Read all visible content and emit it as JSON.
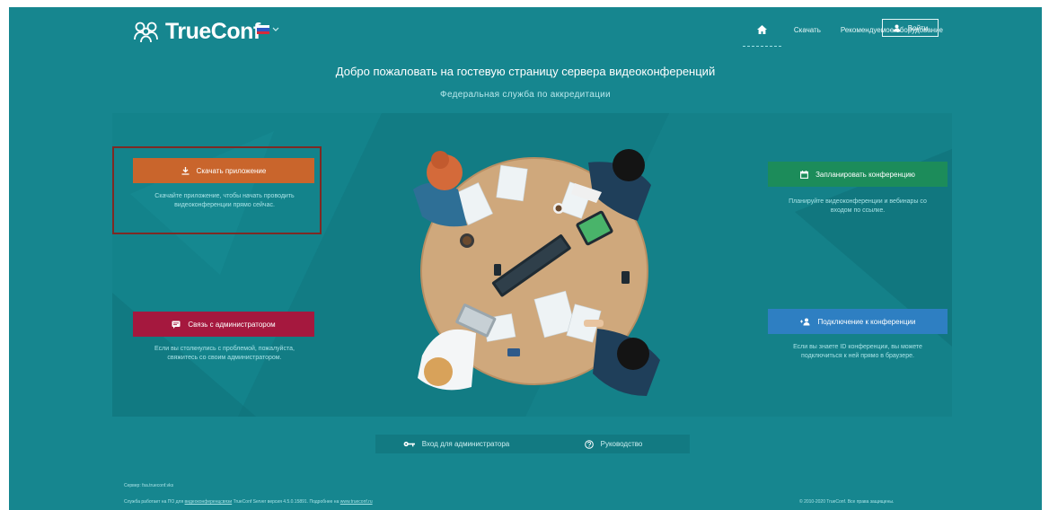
{
  "header": {
    "logo_text": "TrueConf",
    "nav": {
      "download": "Скачать",
      "equipment": "Рекомендуемое оборудование",
      "login": "Войти"
    }
  },
  "main": {
    "title": "Добро пожаловать на гостевую страницу сервера видеоконференций",
    "subtitle": "Федеральная служба по аккредитации"
  },
  "cards": {
    "download": {
      "label": "Скачать приложение",
      "desc": "Скачайте приложение, чтобы начать проводить видеоконференции прямо сейчас."
    },
    "schedule": {
      "label": "Запланировать конференцию",
      "desc": "Планируйте видеоконференции и вебинары со входом по ссылке."
    },
    "admin_contact": {
      "label": "Связь с администратором",
      "desc": "Если вы столкнулись с проблемой, пожалуйста, свяжитесь со своим администратором."
    },
    "join": {
      "label": "Подключение к конференции",
      "desc": "Если вы знаете ID конференции, вы можете подключиться к ней прямо в браузере."
    }
  },
  "bottom": {
    "admin_login": "Вход для администратора",
    "guide": "Руководство"
  },
  "footer": {
    "server": "Сервер: fsa.trueconf.vks",
    "powered_prefix": "Служба работает на ПО для",
    "powered_link": "видеоконференцсвязи",
    "powered_middle": "TrueConf Server версия 4.5.0.15891. Подробнее на",
    "site_link": "www.trueconf.ru",
    "copyright": "© 2010-2020 TrueConf. Все права защищены."
  },
  "colors": {
    "background": "#16868f",
    "panel": "#137e86",
    "download_btn": "#c9652c",
    "schedule_btn": "#1c8c5a",
    "admin_btn": "#a5183e",
    "join_btn": "#2e7fc2",
    "highlight_border": "#7d2a24"
  },
  "icons": {
    "logo": "people-logo-icon",
    "lang": "russian-flag-icon",
    "home": "home-icon",
    "login": "user-icon",
    "download": "download-icon",
    "schedule": "calendar-icon",
    "admin_contact": "chat-icon",
    "join": "add-user-icon",
    "admin_login": "key-icon",
    "guide": "help-circle-icon"
  }
}
